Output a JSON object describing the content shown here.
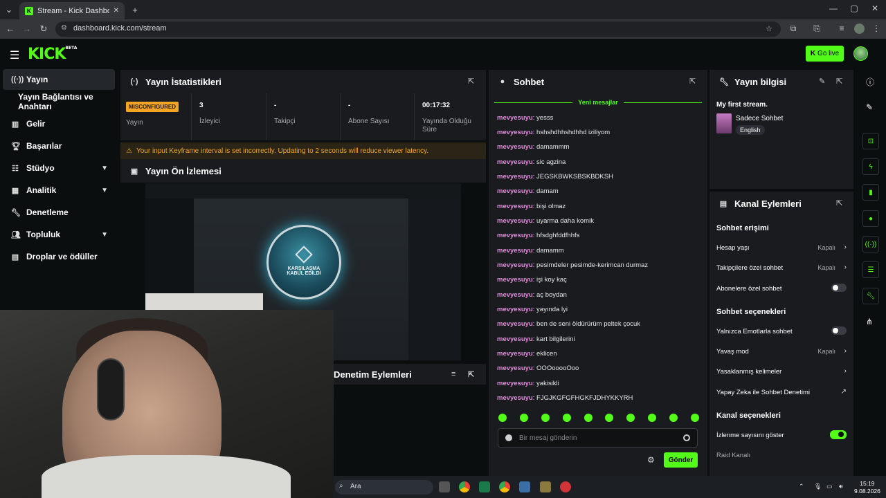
{
  "browser": {
    "tab_title": "Stream - Kick Dashboard",
    "url": "dashboard.kick.com/stream"
  },
  "header": {
    "logo": "KICK",
    "logo_sup": "BETA",
    "go_live": "Go live"
  },
  "sidebar": {
    "items": [
      {
        "label": "Yayın"
      },
      {
        "label": "Yayın Bağlantısı ve Anahtarı"
      },
      {
        "label": "Gelir"
      },
      {
        "label": "Başarılar"
      },
      {
        "label": "Stüdyo"
      },
      {
        "label": "Analitik"
      },
      {
        "label": "Denetleme"
      },
      {
        "label": "Topluluk"
      },
      {
        "label": "Droplar ve ödüller"
      }
    ]
  },
  "stats": {
    "title": "Yayın İstatistikleri",
    "status_badge": "MISCONFIGURED",
    "status_label": "Yayın",
    "viewers_value": "3",
    "viewers_label": "İzleyici",
    "followers_value": "-",
    "followers_label": "Takipçi",
    "subs_value": "-",
    "subs_label": "Abone Sayısı",
    "uptime_value": "00:17:32",
    "uptime_label": "Yayında Olduğu Süre",
    "warning": "Your input Keyframe interval is set incorrectly. Updating to 2 seconds will reduce viewer latency."
  },
  "preview": {
    "title": "Yayın Ön İzlemesi",
    "overlay_line1": "KARŞILAŞMA",
    "overlay_line2": "KABUL EDİLDİ"
  },
  "moderation": {
    "title": "Denetim Eylemleri"
  },
  "chat": {
    "title": "Sohbet",
    "new_messages": "Yeni mesajlar",
    "messages": [
      {
        "user": "mevyesuyu",
        "text": ": yesss"
      },
      {
        "user": "mevyesuyu",
        "text": ": hshshdhhshdhhd iziliyom"
      },
      {
        "user": "mevyesuyu",
        "text": ": damammm"
      },
      {
        "user": "mevyesuyu",
        "text": ": sic agzina"
      },
      {
        "user": "mevyesuyu",
        "text": ": JEGSKBWKSBSKBDKSH"
      },
      {
        "user": "mevyesuyu",
        "text": ": damam"
      },
      {
        "user": "mevyesuyu",
        "text": ": bişi olmaz"
      },
      {
        "user": "mevyesuyu",
        "text": ": uyarma daha komik"
      },
      {
        "user": "mevyesuyu",
        "text": ": hfsdghfddfhhfs"
      },
      {
        "user": "mevyesuyu",
        "text": ": damamm"
      },
      {
        "user": "mevyesuyu",
        "text": ": pesimdeler pesimde-kerimcan durmaz"
      },
      {
        "user": "mevyesuyu",
        "text": ": işi koy kaç"
      },
      {
        "user": "mevyesuyu",
        "text": ": aç boydan"
      },
      {
        "user": "mevyesuyu",
        "text": ": yayında lyi"
      },
      {
        "user": "mevyesuyu",
        "text": ": ben de seni öldürürüm peltek çocuk"
      },
      {
        "user": "mevyesuyu",
        "text": ": kart bilgilerini"
      },
      {
        "user": "mevyesuyu",
        "text": ": eklicen"
      },
      {
        "user": "mevyesuyu",
        "text": ": OOOooooOoo"
      },
      {
        "user": "mevyesuyu",
        "text": ": yakisikli"
      },
      {
        "user": "mevyesuyu",
        "text": ": FJGJKGFGFHGKFJDHYKKYRH"
      }
    ],
    "input_placeholder": "Bir mesaj gönderin",
    "send": "Gönder"
  },
  "stream_info": {
    "title": "Yayın bilgisi",
    "stream_title": "My first stream.",
    "category": "Sadece Sohbet",
    "language": "English"
  },
  "channel_actions": {
    "title": "Kanal Eylemleri",
    "section_chat_access": "Sohbet erişimi",
    "account_age": "Hesap yaşı",
    "account_age_value": "Kapalı",
    "followers_only": "Takipçilere özel sohbet",
    "followers_only_value": "Kapalı",
    "subs_only": "Abonelere özel sohbet",
    "section_chat_options": "Sohbet seçenekleri",
    "emotes_only": "Yalnızca Emotlarla sohbet",
    "slow_mode": "Yavaş mod",
    "slow_mode_value": "Kapalı",
    "banned_words": "Yasaklanmış kelimeler",
    "ai_moderation": "Yapay Zeka ile Sohbet Denetimi",
    "section_channel_options": "Kanal seçenekleri",
    "show_viewer_count": "İzlenme sayısını göster",
    "raid_channel": "Raid Kanalı"
  },
  "taskbar": {
    "search": "Ara",
    "time": "15:19",
    "date": "9.08.2026"
  },
  "colors": {
    "accent": "#53fc18",
    "warning": "#f5a524",
    "username": "#e38cdb"
  }
}
